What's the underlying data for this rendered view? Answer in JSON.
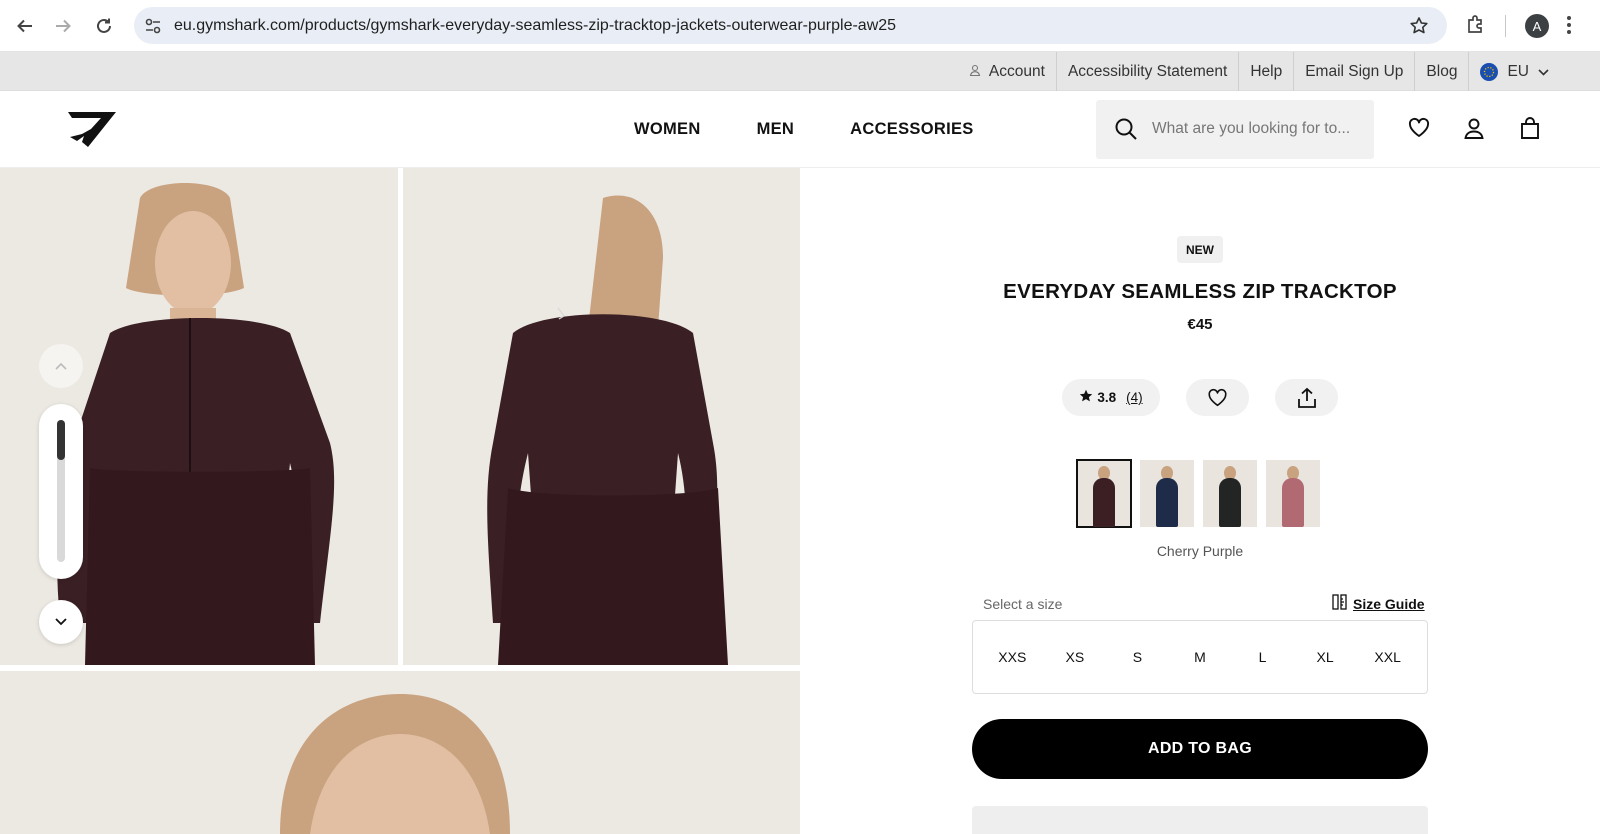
{
  "browser": {
    "url": "eu.gymshark.com/products/gymshark-everyday-seamless-zip-tracktop-jackets-outerwear-purple-aw25",
    "profile_initial": "A"
  },
  "utility_bar": {
    "account": "Account",
    "accessibility": "Accessibility Statement",
    "help": "Help",
    "email_signup": "Email Sign Up",
    "blog": "Blog",
    "region": "EU"
  },
  "header": {
    "nav": [
      "WOMEN",
      "MEN",
      "ACCESSORIES"
    ],
    "search_placeholder": "What are you looking for to..."
  },
  "product": {
    "badge": "NEW",
    "title": "EVERYDAY SEAMLESS ZIP TRACKTOP",
    "price": "€45",
    "rating": "3.8",
    "review_count": "(4)",
    "selected_color": "Cherry Purple",
    "swatch_colors": [
      "#3b1f22",
      "#1e2c4a",
      "#222524",
      "#b26a72"
    ],
    "select_size_label": "Select a size",
    "size_guide": "Size Guide",
    "sizes": [
      "XXS",
      "XS",
      "S",
      "M",
      "L",
      "XL",
      "XXL"
    ],
    "add_to_bag": "ADD TO BAG"
  },
  "colors": {
    "garment": "#3a2024",
    "background": "#ece8e2",
    "accent": "#000000"
  }
}
